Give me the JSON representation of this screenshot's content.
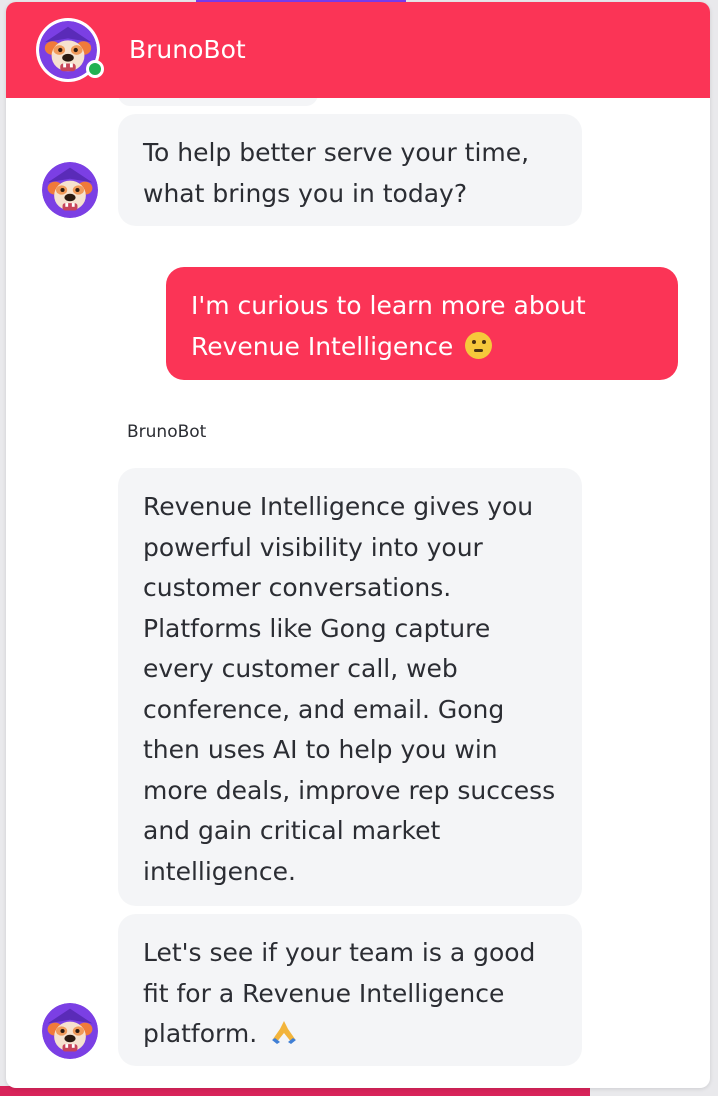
{
  "header": {
    "title": "BrunoBot",
    "status_color": "#22b152",
    "background_color": "#fb3456"
  },
  "messages": [
    {
      "sender": "bot",
      "text": "To help better serve your time, what brings you in today?"
    },
    {
      "sender": "user",
      "text": "I'm curious to learn more about Revenue Intelligence",
      "emoji": "thinking-face"
    },
    {
      "sender_label": "BrunoBot",
      "sender": "bot",
      "text": "Revenue Intelligence gives you powerful visibility into your customer conversations. Platforms like Gong capture every customer call, web conference, and email. Gong then uses AI to help you win more deals, improve rep success and gain critical market intelligence."
    },
    {
      "sender": "bot",
      "text": "Let's see if your team is a good fit for a Revenue Intelligence platform.",
      "emoji": "folded-hands"
    }
  ]
}
